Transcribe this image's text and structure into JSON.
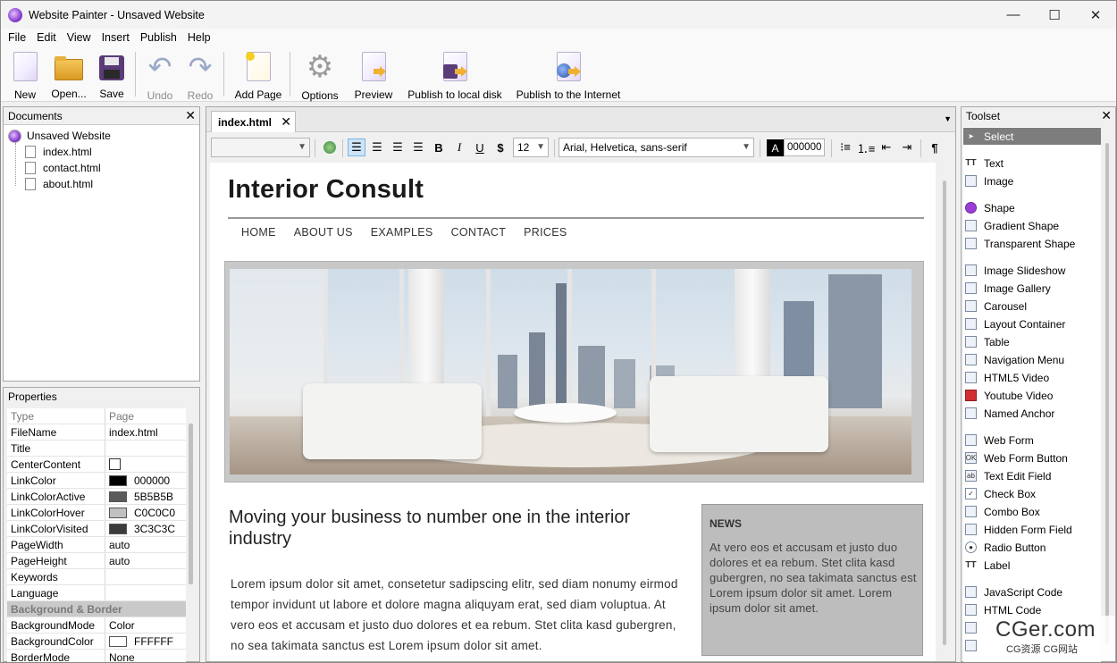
{
  "window": {
    "title": "Website Painter - Unsaved Website"
  },
  "menu": [
    "File",
    "Edit",
    "View",
    "Insert",
    "Publish",
    "Help"
  ],
  "toolbar": {
    "new": "New",
    "open": "Open...",
    "save": "Save",
    "undo": "Undo",
    "redo": "Redo",
    "add_page": "Add Page",
    "options": "Options",
    "preview": "Preview",
    "publish_local": "Publish to local disk",
    "publish_internet": "Publish to the Internet"
  },
  "documents": {
    "title": "Documents",
    "root": "Unsaved Website",
    "files": [
      "index.html",
      "contact.html",
      "about.html"
    ]
  },
  "properties": {
    "title": "Properties",
    "header": {
      "key": "Type",
      "value": "Page"
    },
    "rows": [
      {
        "key": "FileName",
        "value": "index.html"
      },
      {
        "key": "Title",
        "value": ""
      },
      {
        "key": "CenterContent",
        "value": ""
      },
      {
        "key": "LinkColor",
        "value": "000000",
        "color": "#000000"
      },
      {
        "key": "LinkColorActive",
        "value": "5B5B5B",
        "color": "#5B5B5B"
      },
      {
        "key": "LinkColorHover",
        "value": "C0C0C0",
        "color": "#C0C0C0"
      },
      {
        "key": "LinkColorVisited",
        "value": "3C3C3C",
        "color": "#3C3C3C"
      },
      {
        "key": "PageWidth",
        "value": "auto"
      },
      {
        "key": "PageHeight",
        "value": "auto"
      },
      {
        "key": "Keywords",
        "value": ""
      },
      {
        "key": "Language",
        "value": ""
      }
    ],
    "section": "Background & Border",
    "rows2": [
      {
        "key": "BackgroundMode",
        "value": "Color"
      },
      {
        "key": "BackgroundColor",
        "value": "FFFFFF",
        "color": "#FFFFFF"
      },
      {
        "key": "BorderMode",
        "value": "None"
      }
    ]
  },
  "editor": {
    "tab": "index.html",
    "font_size": "12",
    "font_family": "Arial, Helvetica, sans-serif",
    "text_color": "000000",
    "color_letter": "A"
  },
  "site": {
    "title": "Interior Consult",
    "nav": [
      "HOME",
      "ABOUT US",
      "EXAMPLES",
      "CONTACT",
      "PRICES"
    ],
    "heading": "Moving your business to number one in the interior industry",
    "body": "Lorem ipsum dolor sit amet, consetetur sadipscing elitr, sed diam nonumy eirmod tempor invidunt ut labore et dolore magna aliquyam erat, sed diam voluptua. At vero eos et accusam et justo duo dolores et ea rebum. Stet clita kasd gubergren, no sea takimata sanctus est Lorem ipsum dolor sit amet.",
    "news_title": "NEWS",
    "news_body": "At vero eos et accusam et justo duo dolores et ea rebum. Stet clita kasd gubergren, no sea takimata sanctus est Lorem ipsum dolor sit amet. Lorem ipsum dolor sit amet."
  },
  "toolset": {
    "title": "Toolset",
    "items": [
      "Select",
      "Text",
      "Image",
      "Shape",
      "Gradient Shape",
      "Transparent Shape",
      "Image Slideshow",
      "Image Gallery",
      "Carousel",
      "Layout Container",
      "Table",
      "Navigation Menu",
      "HTML5 Video",
      "Youtube Video",
      "Named Anchor",
      "Web Form",
      "Web Form Button",
      "Text Edit Field",
      "Check Box",
      "Combo Box",
      "Hidden Form Field",
      "Radio Button",
      "Label",
      "JavaScript Code",
      "HTML Code"
    ]
  },
  "watermark": {
    "main": "CGer.com",
    "sub": "CG资源 CG网站"
  }
}
